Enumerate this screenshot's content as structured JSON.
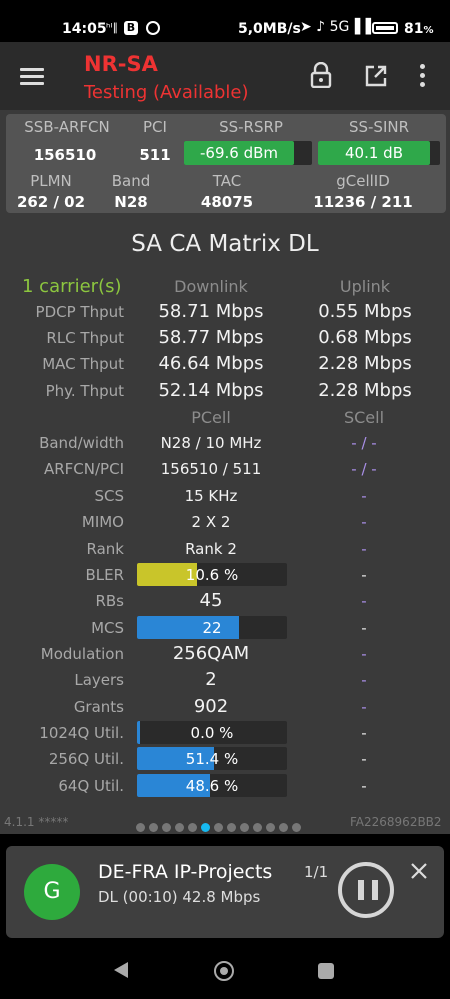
{
  "status_bar": {
    "time": "14:05",
    "signal": "ʰᴵ∥",
    "b_badge": "B",
    "speed": "5,0MB/s",
    "icons": "➤ ♪ 5G▐▐",
    "battery_pct": "81",
    "battery_suffix": "%"
  },
  "app_bar": {
    "title": "NR-SA",
    "subtitle": "Testing (Available)",
    "accent_color": "#e33333"
  },
  "cell_info": {
    "headers_row1": [
      "SSB-ARFCN",
      "PCI",
      "SS-RSRP",
      "SS-SINR"
    ],
    "ssb_arfcn": "156510",
    "pci": "511",
    "ss_rsrp": "-69.6 dBm",
    "ss_sinr": "40.1 dB",
    "headers_row2": [
      "PLMN",
      "Band",
      "TAC",
      "gCellID"
    ],
    "plmn": "262 / 02",
    "band": "N28",
    "tac": "48075",
    "gcellid": "11236 / 211"
  },
  "matrix": {
    "title": "SA CA Matrix DL",
    "carriers": "1 carrier(s)",
    "downlink_header": "Downlink",
    "uplink_header": "Uplink",
    "throughput": [
      {
        "label": "PDCP Thput",
        "dl": "58.71 Mbps",
        "ul": "0.55 Mbps"
      },
      {
        "label": "RLC Thput",
        "dl": "58.77 Mbps",
        "ul": "0.68 Mbps"
      },
      {
        "label": "MAC Thput",
        "dl": "46.64 Mbps",
        "ul": "2.28 Mbps"
      },
      {
        "label": "Phy. Thput",
        "dl": "52.14 Mbps",
        "ul": "2.28 Mbps"
      }
    ],
    "pcell_header": "PCell",
    "scell_header": "SCell",
    "band_width": {
      "label": "Band/width",
      "pcell": "N28 / 10 MHz",
      "scell": "- / -"
    },
    "arfcn_pci": {
      "label": "ARFCN/PCI",
      "pcell": "156510 / 511",
      "scell": "- / -"
    },
    "scs": {
      "label": "SCS",
      "pcell": "15 KHz",
      "scell": "-"
    },
    "mimo": {
      "label": "MIMO",
      "pcell": "2 X 2",
      "scell": "-"
    },
    "rank": {
      "label": "Rank",
      "pcell": "Rank 2",
      "scell": "-"
    },
    "bler": {
      "label": "BLER",
      "pcell": "10.6 %",
      "fill_fraction": 0.4,
      "scell": "-"
    },
    "rbs": {
      "label": "RBs",
      "pcell": "45",
      "scell": "-"
    },
    "mcs": {
      "label": "MCS",
      "pcell": "22",
      "fill_fraction": 0.68,
      "scell": "-"
    },
    "modulation": {
      "label": "Modulation",
      "pcell": "256QAM",
      "scell": "-"
    },
    "layers": {
      "label": "Layers",
      "pcell": "2",
      "scell": "-"
    },
    "grants": {
      "label": "Grants",
      "pcell": "902",
      "scell": "-"
    },
    "util_1024q": {
      "label": "1024Q Util.",
      "pcell": "0.0 %",
      "fill_fraction": 0.0,
      "scell": "-"
    },
    "util_256q": {
      "label": "256Q Util.",
      "pcell": "51.4 %",
      "fill_fraction": 0.514,
      "scell": "-"
    },
    "util_64q": {
      "label": "64Q Util.",
      "pcell": "48.6 %",
      "fill_fraction": 0.486,
      "scell": "-"
    }
  },
  "footer": {
    "version": "4.1.1 *****",
    "device_id": "FA2268962BB2",
    "page_count": 13,
    "active_page": 6
  },
  "notification": {
    "avatar_letter": "G",
    "title": "DE-FRA IP-Projects",
    "subtitle": "DL (00:10) 42.8 Mbps",
    "count": "1/1"
  },
  "colors": {
    "bler_fill": "#c9c52a",
    "blue_fill": "#2a86d6",
    "green_fill": "#2fa84a",
    "carrier_green": "#8cc63f",
    "scell_purple": "#a98fe8"
  }
}
